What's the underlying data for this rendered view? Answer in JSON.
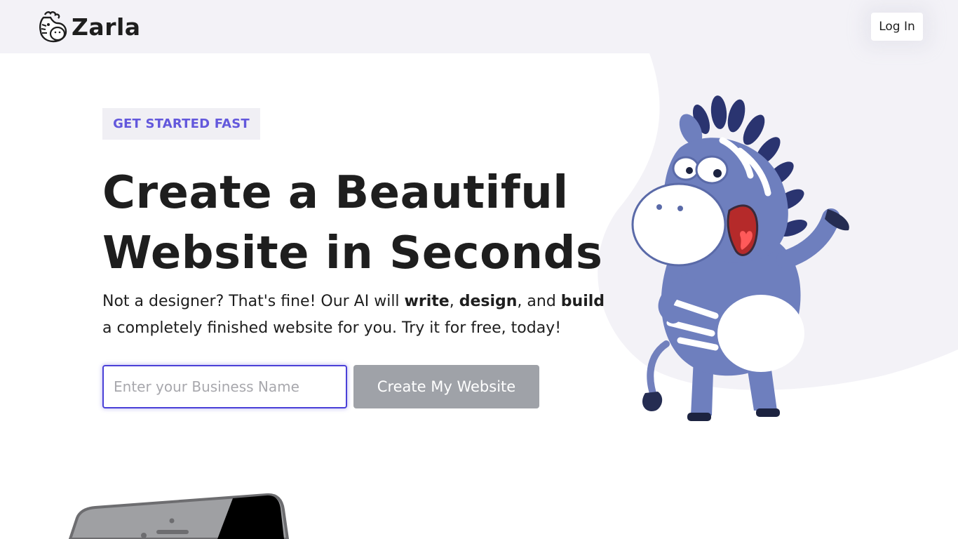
{
  "brand": {
    "name": "Zarla",
    "logo_icon": "zebra-head-icon",
    "accent_color": "#6358dc"
  },
  "header": {
    "login_label": "Log In"
  },
  "hero": {
    "eyebrow": "GET STARTED FAST",
    "headline_line1": "Create a Beautiful",
    "headline_line2": "Website in Seconds",
    "sub_part1": "Not a designer? That's fine! Our AI will ",
    "sub_bold1": "write",
    "sub_part2": ", ",
    "sub_bold2": "design",
    "sub_part3": ", and ",
    "sub_bold3": "build",
    "sub_part4": " a completely finished website for you. Try it for free, today!",
    "input_placeholder": "Enter your Business Name",
    "input_value": "",
    "cta_label": "Create My Website",
    "cta_color": "#9fa2a8"
  },
  "illustrations": {
    "mascot": "zebra-mascot-illustration",
    "device": "phone-illustration"
  }
}
